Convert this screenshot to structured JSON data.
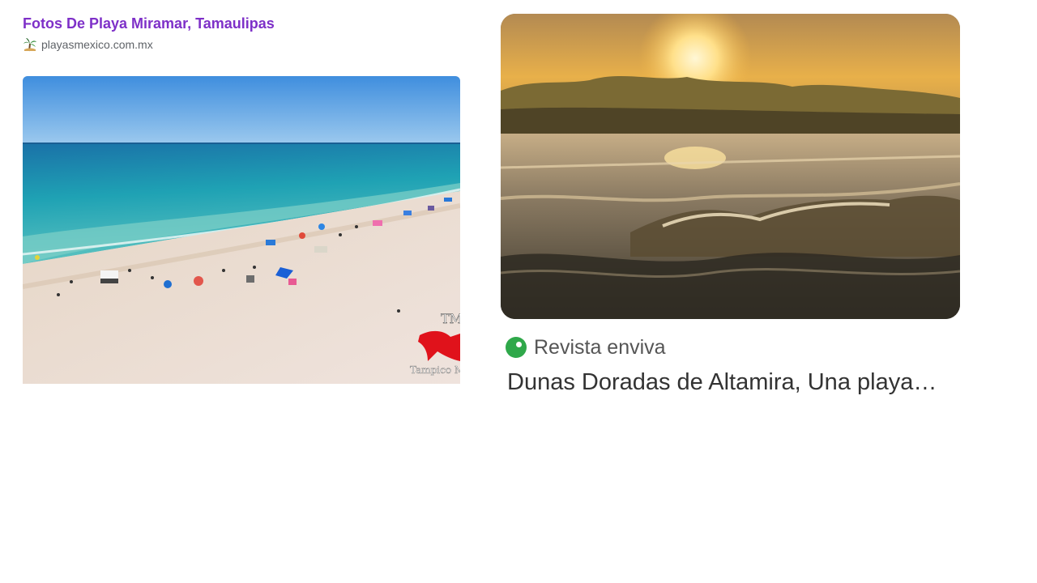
{
  "results": {
    "left": {
      "title": "Fotos De Playa Miramar, Tamaulipas",
      "source_icon": "palm-tree-icon",
      "source": "playasmexico.com.mx",
      "image": {
        "description_icon": "beach-aerial-photo",
        "watermark": "Tampico Me"
      }
    },
    "right": {
      "image": {
        "description_icon": "sunset-waves-photo"
      },
      "publisher_icon": "green-circle-icon",
      "publisher": "Revista enviva",
      "title": "Dunas Doradas de Altamira, Una playa…"
    }
  },
  "colors": {
    "title_link": "#7e30c8",
    "source_text": "#5f6368",
    "publisher_icon": "#2fa84a",
    "article_title": "#333333"
  }
}
